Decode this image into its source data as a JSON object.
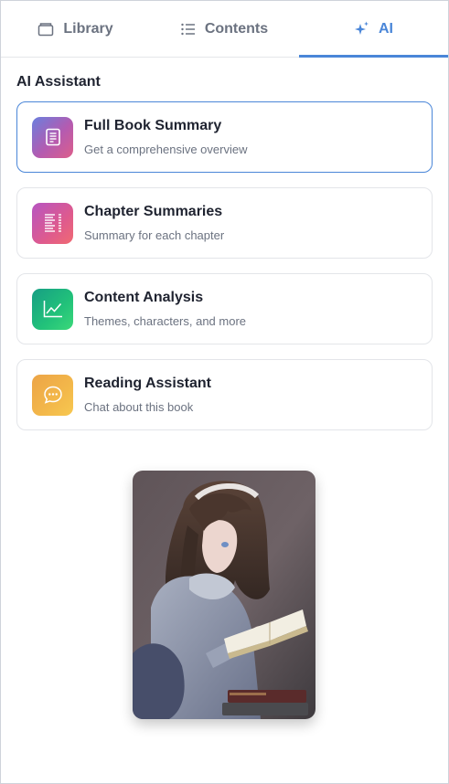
{
  "tabs": [
    {
      "label": "Library",
      "icon": "folder-icon",
      "active": false
    },
    {
      "label": "Contents",
      "icon": "list-icon",
      "active": false
    },
    {
      "label": "AI",
      "icon": "sparkles-icon",
      "active": true
    }
  ],
  "section_title": "AI Assistant",
  "cards": [
    {
      "title": "Full Book Summary",
      "subtitle": "Get a comprehensive overview",
      "icon": "document-icon",
      "selected": true
    },
    {
      "title": "Chapter Summaries",
      "subtitle": "Summary for each chapter",
      "icon": "list-lines-icon",
      "selected": false
    },
    {
      "title": "Content Analysis",
      "subtitle": "Themes, characters, and more",
      "icon": "line-chart-icon",
      "selected": false
    },
    {
      "title": "Reading Assistant",
      "subtitle": "Chat about this book",
      "icon": "chat-bubble-icon",
      "selected": false
    }
  ],
  "colors": {
    "accent": "#4a86d8",
    "text_primary": "#1f2330",
    "text_secondary": "#6b7280",
    "border": "#e3e5e9"
  },
  "illustration": {
    "icon": "girl-reading-book-illustration"
  }
}
